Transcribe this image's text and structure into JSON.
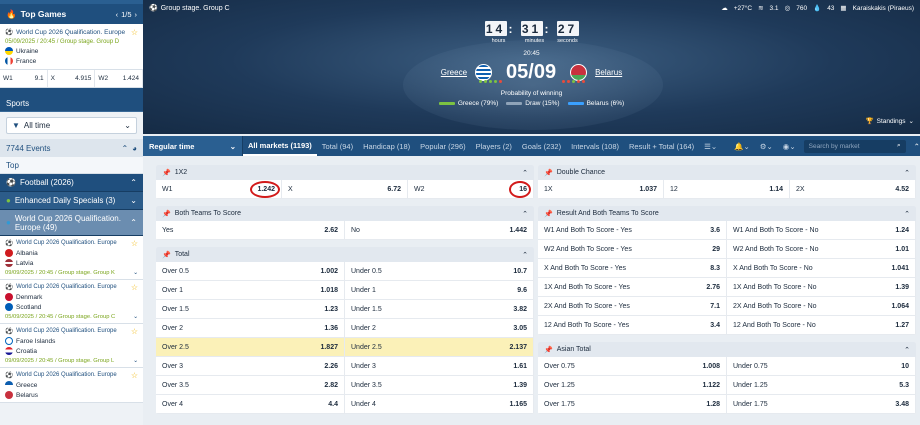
{
  "sidebar": {
    "top_games": {
      "title": "Top Games",
      "pager": "1/5",
      "card": {
        "competition": "World Cup 2026 Qualification. Europe",
        "meta": "05/09/2025 / 20:45 / Group stage. Group D",
        "team1": "Ukraine",
        "team2": "France"
      },
      "odds": [
        {
          "label": "W1",
          "value": "9.1"
        },
        {
          "label": "X",
          "value": "4.915"
        },
        {
          "label": "W2",
          "value": "1.424"
        }
      ]
    },
    "sports_title": "Sports",
    "period": "All time",
    "events": "7744 Events",
    "top": "Top",
    "cats": [
      {
        "label": "Football (2026)"
      },
      {
        "label": "Enhanced Daily Specials (3)"
      }
    ],
    "league": "World Cup 2026 Qualification. Europe (49)",
    "matches": [
      {
        "competition": "World Cup 2026 Qualification. Europe",
        "team1": "Albania",
        "team2": "Latvia",
        "meta": "09/09/2025 / 20:45 / Group stage. Group K",
        "c1": "#d01c1f",
        "c2": "#9e3039"
      },
      {
        "competition": "World Cup 2026 Qualification. Europe",
        "team1": "Denmark",
        "team2": "Scotland",
        "meta": "05/09/2025 / 20:45 / Group stage. Group C",
        "c1": "#c8102e",
        "c2": "#005eb8"
      },
      {
        "competition": "World Cup 2026 Qualification. Europe",
        "team1": "Faroe Islands",
        "team2": "Croatia",
        "meta": "09/09/2025 / 20:45 / Group stage. Group L",
        "c1": "#ffffff",
        "c2": "#e3242b"
      },
      {
        "competition": "World Cup 2026 Qualification. Europe",
        "team1": "Greece",
        "team2": "Belarus",
        "meta": "",
        "c1": "#0d5eaf",
        "c2": "#c8313e"
      }
    ]
  },
  "hero": {
    "stage": "Group stage. Group C",
    "weather": {
      "temp": "+27°C",
      "wind": "3.1",
      "pressure": "760",
      "humidity": "43",
      "venue": "Karaiskakis (Piraeus)"
    },
    "timer": {
      "hours": "14",
      "minutes": "31",
      "seconds": "27",
      "hours_label": "hours",
      "minutes_label": "minutes",
      "seconds_label": "seconds"
    },
    "kickoff": "20:45",
    "team1": "Greece",
    "team2": "Belarus",
    "date": "05/09",
    "prob_title": "Probability of winning",
    "legend": [
      {
        "label": "Greece (79%)",
        "color": "#7cc242"
      },
      {
        "label": "Draw (15%)",
        "color": "#8fa3b8"
      },
      {
        "label": "Belarus (6%)",
        "color": "#3aa0ff"
      }
    ],
    "standings": "Standings"
  },
  "market_bar": {
    "regular": "Regular time",
    "tabs": [
      "All markets (1193)",
      "Total (94)",
      "Handicap (18)",
      "Popular (296)",
      "Players (2)",
      "Goals (232)",
      "Intervals (108)",
      "Result + Total (164)"
    ],
    "search_placeholder": "Search by market"
  },
  "markets": {
    "x12": {
      "title": "1X2",
      "cells": [
        {
          "l": "W1",
          "v": "1.242"
        },
        {
          "l": "X",
          "v": "6.72"
        },
        {
          "l": "W2",
          "v": "16"
        }
      ]
    },
    "btts": {
      "title": "Both Teams To Score",
      "cells": [
        {
          "l": "Yes",
          "v": "2.62"
        },
        {
          "l": "No",
          "v": "1.442"
        }
      ]
    },
    "total": {
      "title": "Total",
      "rows": [
        {
          "a": "Over 0.5",
          "av": "1.002",
          "b": "Under 0.5",
          "bv": "10.7"
        },
        {
          "a": "Over 1",
          "av": "1.018",
          "b": "Under 1",
          "bv": "9.6"
        },
        {
          "a": "Over 1.5",
          "av": "1.23",
          "b": "Under 1.5",
          "bv": "3.82"
        },
        {
          "a": "Over 2",
          "av": "1.36",
          "b": "Under 2",
          "bv": "3.05"
        },
        {
          "a": "Over 2.5",
          "av": "1.827",
          "b": "Under 2.5",
          "bv": "2.137"
        },
        {
          "a": "Over 3",
          "av": "2.26",
          "b": "Under 3",
          "bv": "1.61"
        },
        {
          "a": "Over 3.5",
          "av": "2.82",
          "b": "Under 3.5",
          "bv": "1.39"
        },
        {
          "a": "Over 4",
          "av": "4.4",
          "b": "Under 4",
          "bv": "1.165"
        }
      ]
    },
    "dc": {
      "title": "Double Chance",
      "cells": [
        {
          "l": "1X",
          "v": "1.037"
        },
        {
          "l": "12",
          "v": "1.14"
        },
        {
          "l": "2X",
          "v": "4.52"
        }
      ]
    },
    "rbtts": {
      "title": "Result And Both Teams To Score",
      "rows": [
        {
          "a": "W1 And Both To Score - Yes",
          "av": "3.6",
          "b": "W1 And Both To Score - No",
          "bv": "1.24"
        },
        {
          "a": "W2 And Both To Score - Yes",
          "av": "29",
          "b": "W2 And Both To Score - No",
          "bv": "1.01"
        },
        {
          "a": "X And Both To Score - Yes",
          "av": "8.3",
          "b": "X And Both To Score - No",
          "bv": "1.041"
        },
        {
          "a": "1X And Both To Score - Yes",
          "av": "2.76",
          "b": "1X And Both To Score - No",
          "bv": "1.39"
        },
        {
          "a": "2X And Both To Score - Yes",
          "av": "7.1",
          "b": "2X And Both To Score - No",
          "bv": "1.064"
        },
        {
          "a": "12 And Both To Score - Yes",
          "av": "3.4",
          "b": "12 And Both To Score - No",
          "bv": "1.27"
        }
      ]
    },
    "asian": {
      "title": "Asian Total",
      "rows": [
        {
          "a": "Over 0.75",
          "av": "1.008",
          "b": "Under 0.75",
          "bv": "10"
        },
        {
          "a": "Over 1.25",
          "av": "1.122",
          "b": "Under 1.25",
          "bv": "5.3"
        },
        {
          "a": "Over 1.75",
          "av": "1.28",
          "b": "Under 1.75",
          "bv": "3.48"
        }
      ]
    }
  }
}
